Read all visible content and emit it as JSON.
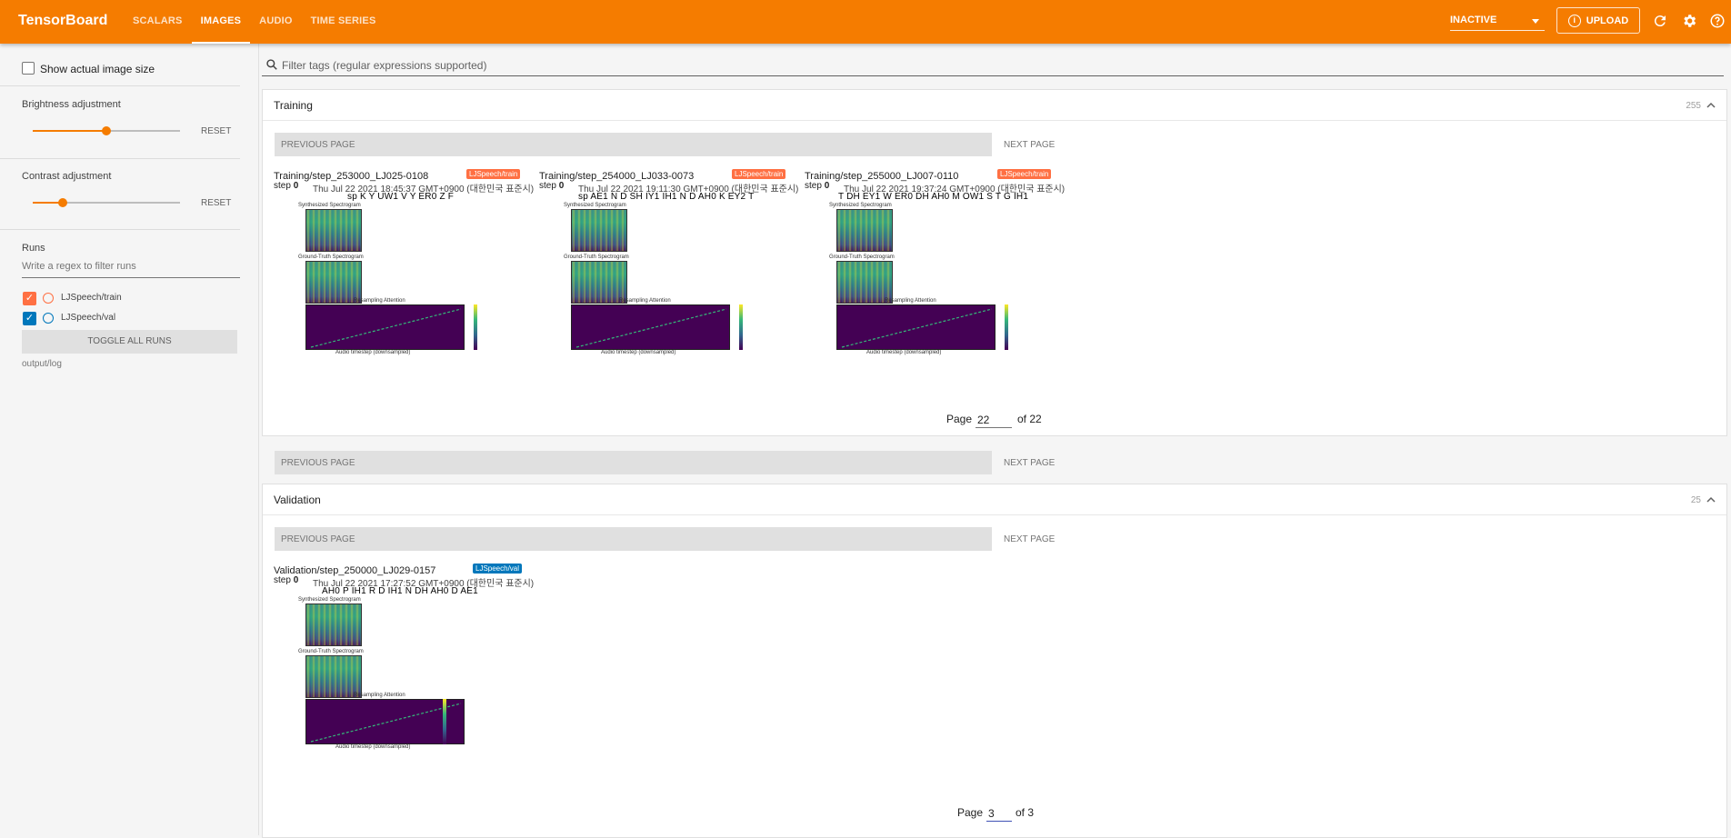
{
  "app": {
    "brand": "TensorBoard"
  },
  "nav": {
    "tabs": [
      {
        "label": "SCALARS",
        "active": false
      },
      {
        "label": "IMAGES",
        "active": true
      },
      {
        "label": "AUDIO",
        "active": false
      },
      {
        "label": "TIME SERIES",
        "active": false
      }
    ],
    "run_select": "INACTIVE",
    "upload_label": "UPLOAD",
    "icons": [
      "refresh-icon",
      "settings-icon",
      "help-icon"
    ]
  },
  "sidebar": {
    "show_actual_size": "Show actual image size",
    "brightness": {
      "label": "Brightness adjustment",
      "reset": "RESET",
      "level": 0.5
    },
    "contrast": {
      "label": "Contrast adjustment",
      "reset": "RESET",
      "level": 0.2
    },
    "runs": {
      "title": "Runs",
      "filter_placeholder": "Write a regex to filter runs",
      "items": [
        {
          "name": "LJSpeech/train",
          "color": "#ff7043",
          "checked": true
        },
        {
          "name": "LJSpeech/val",
          "color": "#0077bb",
          "checked": true
        }
      ],
      "toggle_all": "TOGGLE ALL RUNS",
      "logdir": "output/log"
    }
  },
  "main": {
    "filter_placeholder": "Filter tags (regular expressions supported)",
    "sections": [
      {
        "title": "Training",
        "count": "255",
        "prev": "PREVIOUS PAGE",
        "next": "NEXT PAGE",
        "page_label": "Page",
        "page": "22",
        "of_label": "of 22",
        "images": [
          {
            "tag": "Training/step_253000_LJ025-0108",
            "run": "LJSpeech/train",
            "step_label": "step",
            "step": "0",
            "time": "Thu Jul 22 2021 18:45:37 GMT+0900 (대한민국 표준시)",
            "phonemes": "sp K Y UW1 V Y ER0 Z F"
          },
          {
            "tag": "Training/step_254000_LJ033-0073",
            "run": "LJSpeech/train",
            "step_label": "step",
            "step": "0",
            "time": "Thu Jul 22 2021 19:11:30 GMT+0900 (대한민국 표준시)",
            "phonemes": "sp AE1 N D SH IY1 IH1 N D AH0 K EY2 T"
          },
          {
            "tag": "Training/step_255000_LJ007-0110",
            "run": "LJSpeech/train",
            "step_label": "step",
            "step": "0",
            "time": "Thu Jul 22 2021 19:37:24 GMT+0900 (대한민국 표준시)",
            "phonemes": "T DH EY1 W ER0 DH AH0 M OW1 S T G IH1"
          }
        ]
      },
      {
        "title": "Validation",
        "count": "25",
        "prev": "PREVIOUS PAGE",
        "next": "NEXT PAGE",
        "page_label": "Page",
        "page": "3",
        "of_label": "of 3",
        "images": [
          {
            "tag": "Validation/step_250000_LJ029-0157",
            "run": "LJSpeech/val",
            "step_label": "step",
            "step": "0",
            "time": "Thu Jul 22 2021 17:27:52 GMT+0900 (대한민국 표준시)",
            "phonemes": "AH0 P IH1 R D IH1 N DH AH0 D AE1"
          }
        ]
      }
    ],
    "plot_labels": {
      "synth": "Synthesized Spectrogram",
      "gt": "Ground-Truth Spectrogram",
      "attn": "Resampling Attention",
      "xlabel": "Audio timestep (downsampled)"
    }
  }
}
